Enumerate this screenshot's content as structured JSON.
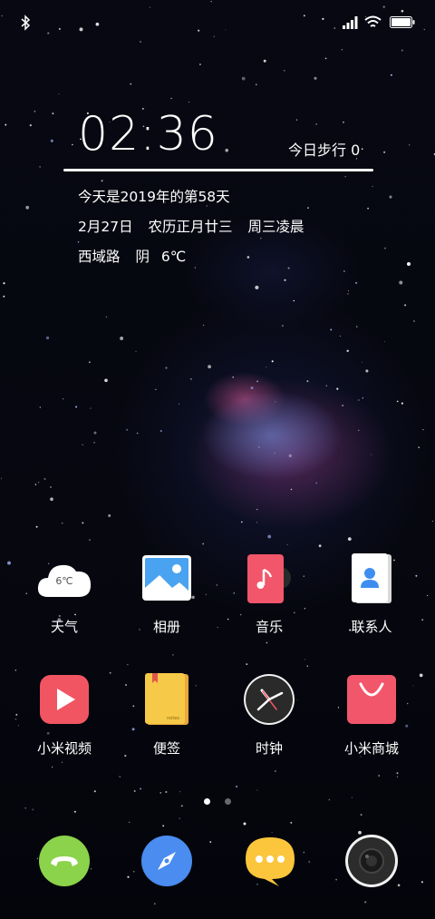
{
  "status_bar": {
    "left_icons": [
      "bluetooth-icon"
    ],
    "right_icons": [
      "signal-icon",
      "wifi-icon",
      "battery-icon"
    ]
  },
  "clock_widget": {
    "time": "02:36",
    "steps": "今日步行 0",
    "day_of_year": "今天是2019年的第58天",
    "date": "2月27日",
    "lunar": "农历正月廿三",
    "weekday_period": "周三凌晨",
    "location": "西域路",
    "weather": "阴",
    "temperature": "6℃"
  },
  "apps": [
    {
      "label": "天气",
      "icon": "weather-icon",
      "icon_text": "6℃",
      "color": "#ffffff"
    },
    {
      "label": "相册",
      "icon": "gallery-icon",
      "color": "#4aa3f0"
    },
    {
      "label": "音乐",
      "icon": "music-icon",
      "color": "#f2566a"
    },
    {
      "label": "联系人",
      "icon": "contacts-icon",
      "color": "#ffffff"
    },
    {
      "label": "小米视频",
      "icon": "video-play-icon",
      "color": "#f25562"
    },
    {
      "label": "便签",
      "icon": "notes-icon",
      "icon_text": "notes",
      "color": "#f7c948"
    },
    {
      "label": "时钟",
      "icon": "clock-icon",
      "color": "#2a2a2a"
    },
    {
      "label": "小米商城",
      "icon": "shopping-bag-icon",
      "color": "#f2566a"
    }
  ],
  "page_indicator": {
    "pages": 2,
    "current": 1
  },
  "dock": [
    {
      "icon": "phone-icon",
      "color": "#8bd34a"
    },
    {
      "icon": "browser-compass-icon",
      "color": "#4a8cf0"
    },
    {
      "icon": "messages-icon",
      "color": "#fbc53c"
    },
    {
      "icon": "camera-icon",
      "color": "#2c2c2c"
    }
  ]
}
